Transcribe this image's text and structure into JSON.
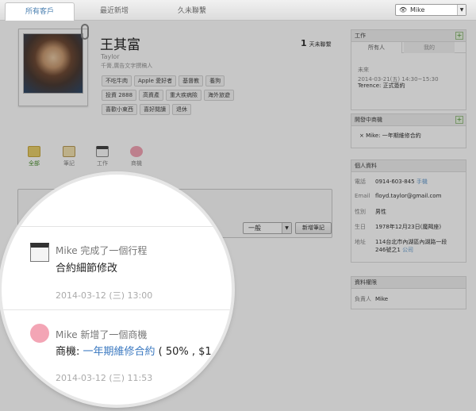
{
  "nav": {
    "tabs": [
      "所有客戶",
      "最近新增",
      "久未聯繫"
    ],
    "user_select": "Mike"
  },
  "profile": {
    "name": "王其富",
    "english_name": "Taylor",
    "title": "千膏,廣告文字撰稿人",
    "contact_days": "1",
    "contact_label": "天未聯繫",
    "tags": [
      [
        "不吃牛肉",
        "Apple 愛好者",
        "基督教",
        "養狗"
      ],
      [
        "投資 2888",
        "高資產",
        "重大疾病險",
        "海外旅遊"
      ],
      [
        "喜歡小東西",
        "喜好閱讀",
        "退休"
      ]
    ]
  },
  "actions": [
    "全部",
    "筆記",
    "工作",
    "商機"
  ],
  "note": {
    "type_select": "一般",
    "add_button": "新增筆記"
  },
  "work_panel": {
    "title": "工作",
    "tabs": [
      "所有人",
      "我的"
    ],
    "section": "未來",
    "date": "2014-03-21(五) 14:30~15:30",
    "item": "Terence: 正式簽約"
  },
  "deals_panel": {
    "title": "開發中商機",
    "item": "Mike: 一年期維修合約"
  },
  "personal_panel": {
    "title": "個人資料",
    "rows": [
      {
        "k": "電話",
        "v": "0914-603-845",
        "note": "手機"
      },
      {
        "k": "Email",
        "v": "floyd.taylor@gmail.com",
        "note": ""
      },
      {
        "k": "性別",
        "v": "男性",
        "note": ""
      },
      {
        "k": "生日",
        "v": "1978年12月23日(魔羯座)",
        "note": ""
      },
      {
        "k": "地址",
        "v": "114台北市內湖區內湖路一段",
        "note": ""
      },
      {
        "k": "",
        "v": "246號之1",
        "note": "公司"
      }
    ]
  },
  "permission_panel": {
    "title": "資料權限",
    "k": "負責人",
    "v": "Mike"
  },
  "feed": [
    {
      "icon": "calendar-clock-icon",
      "head": "Mike  完成了一個行程",
      "body": "合約細節修改",
      "time": "2014-03-12 (三) 13:00"
    },
    {
      "icon": "piggy-bank-icon",
      "head": "Mike  新增了一個商機",
      "body_prefix": "商機: ",
      "body_link": "一年期維修合約",
      "body_suffix": " ( 50% , $1",
      "time": "2014-03-12 (三) 11:53"
    }
  ]
}
